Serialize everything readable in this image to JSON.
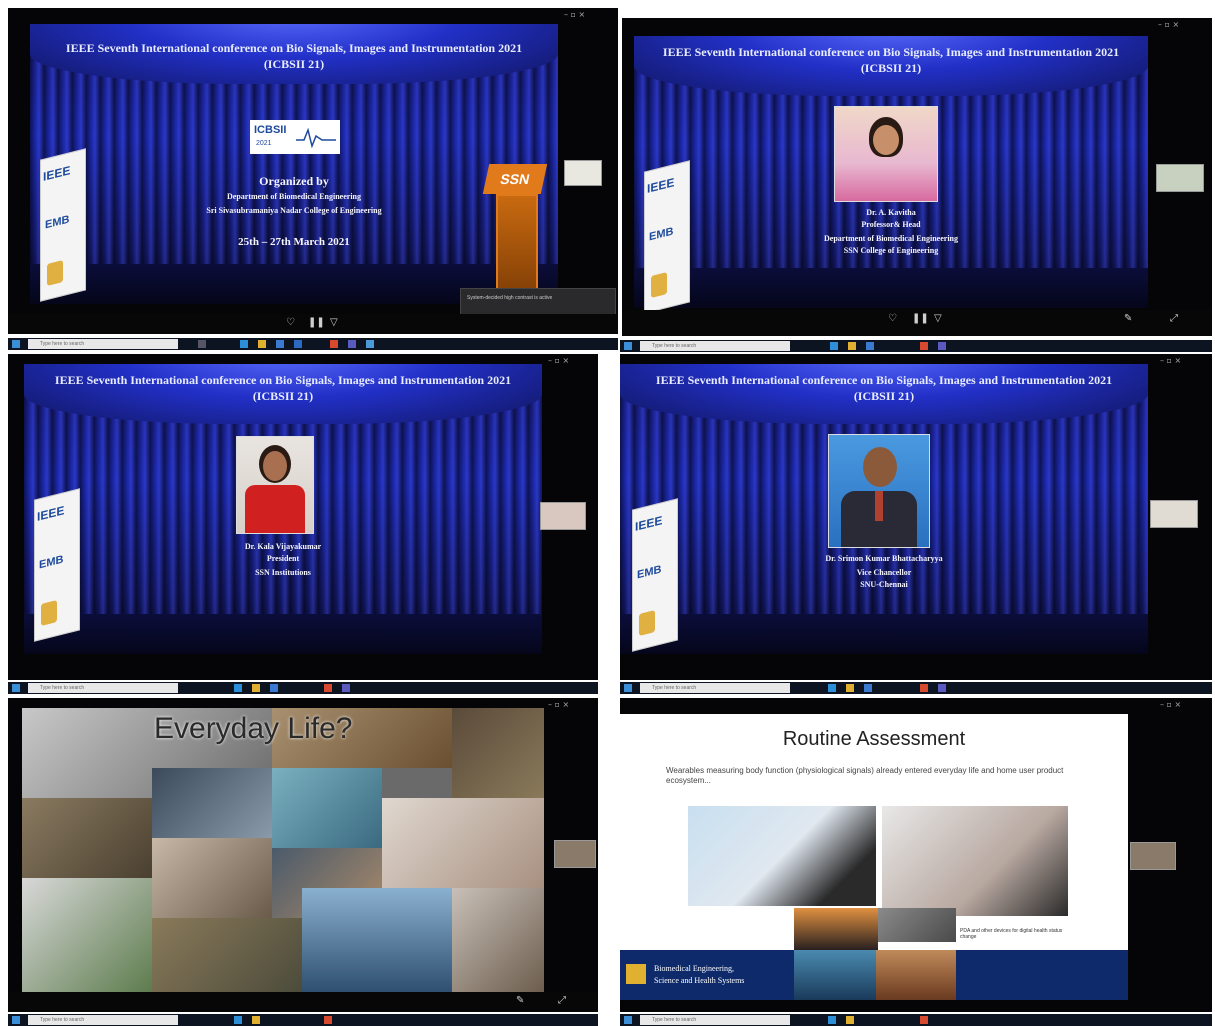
{
  "conference_title_line1": "IEEE Seventh International conference on Bio Signals, Images and Instrumentation 2021",
  "conference_title_line2": "(ICBSII 21)",
  "taskbar_search_placeholder": "Type here to search",
  "panel1": {
    "logo_text": "ICBSII",
    "logo_year": "2021",
    "organized_by": "Organized by",
    "department": "Department of Biomedical Engineering",
    "college": "Sri Sivasubramaniya Nadar College of Engineering",
    "dates": "25th – 27th March 2021",
    "podium_logo": "SSN",
    "banner_ieee": "IEEE",
    "banner_embs": "EMB",
    "popup_text": "System-decided high contrast is active"
  },
  "panel2": {
    "name": "Dr. A. Kavitha",
    "role": "Professor& Head",
    "dept": "Department of Biomedical Engineering",
    "college": "SSN College of Engineering"
  },
  "panel3": {
    "name": "Dr. Kala Vijayakumar",
    "role": "President",
    "org": "SSN Institutions"
  },
  "panel4": {
    "name": "Dr. Srimon Kumar Bhattacharyya",
    "role": "Vice Chancellor",
    "org": "SNU-Chennai"
  },
  "panel5": {
    "title": "Everyday Life?"
  },
  "panel6": {
    "title": "Routine Assessment",
    "body": "Wearables measuring body function (physiological signals) already entered everyday life and home user product ecosystem...",
    "caption": "PDA and other devices for digital health status change",
    "footer_line1": "Biomedical Engineering,",
    "footer_line2": "Science and Health Systems"
  },
  "colors": {
    "stage_blue": "#1d2bb8",
    "taskbar": "#0b1420",
    "ieee_blue": "#1d4a9c",
    "ssn_orange": "#e07a1a"
  }
}
